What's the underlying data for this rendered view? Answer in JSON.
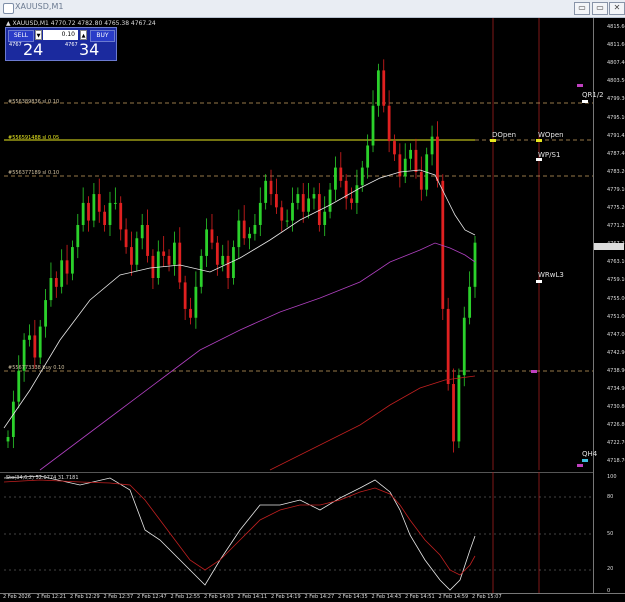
{
  "window": {
    "title": "XAUUSD,M1",
    "min_btn": "▭",
    "close_btn": "✕"
  },
  "symbol_info": "▲ XAUUSD,M1  4770.72 4782.80 4765.38 4767.24",
  "trade_panel": {
    "sell_label": "SELL",
    "buy_label": "BUY",
    "lot": "0.10",
    "sell_prefix": "4767",
    "sell_big": "24",
    "buy_prefix": "4767",
    "buy_big": "34",
    "dropdown": "▼",
    "up": "▲"
  },
  "levels": {
    "r1": "#556389836 sl 0.10",
    "r2": "#556591488 sl 0.05",
    "r3": "#556377189 sl 0.10",
    "r4": "#556773338 buy 0.10",
    "dopen": "DOpen",
    "wopen": "WOpen",
    "wps1": "WP/S1",
    "wrwl3": "WRwL3",
    "qr12": "QR1/2",
    "qh4": "QH4"
  },
  "price_scale": [
    "4815.60",
    "4811.60",
    "4807.40",
    "4803.50",
    "4799.30",
    "4795.10",
    "4791.45",
    "4787.40",
    "4783.20",
    "4779.10",
    "4775.20",
    "4771.20",
    "4767.24",
    "4763.10",
    "4759.10",
    "4755.00",
    "4751.00",
    "4747.00",
    "4742.90",
    "4738.90",
    "4734.90",
    "4730.80",
    "4726.80",
    "4722.70",
    "4718.70"
  ],
  "stoch_scale": [
    "100",
    "80",
    "50",
    "20",
    "0"
  ],
  "stoch_label": "Sto(34,6,2) 52.0774 31.7181",
  "time_axis": [
    "2 Feb 2026",
    "2 Feb 12:21",
    "2 Feb 12:29",
    "2 Feb 12:37",
    "2 Feb 12:47",
    "2 Feb 12:55",
    "2 Feb 14:03",
    "2 Feb 14:11",
    "2 Feb 14:19",
    "2 Feb 14:27",
    "2 Feb 14:35",
    "2 Feb 14:43",
    "2 Feb 14:51",
    "2 Feb 14:59",
    "2 Feb 15:07"
  ],
  "colors": {
    "bull": "#2bd12b",
    "bear": "#e02020",
    "ma_fast": "#e8e8e8",
    "ma_mid": "#b040c0",
    "ma_slow": "#c02020",
    "level_line": "#c8a060",
    "yellow": "#e8e820"
  }
}
